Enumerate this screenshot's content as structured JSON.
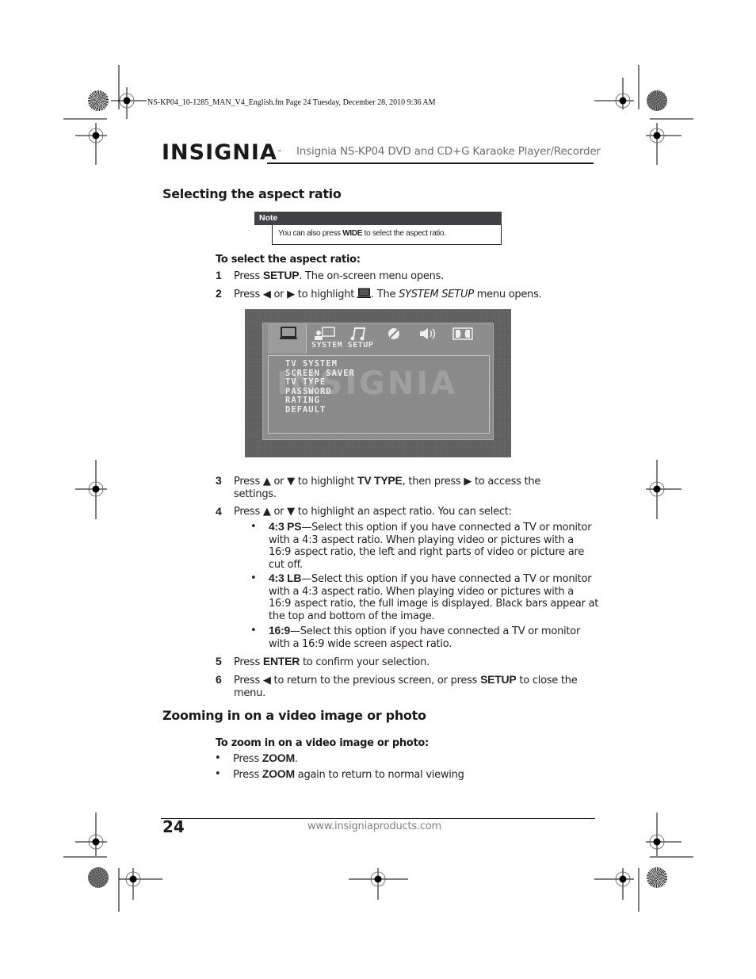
{
  "slugline": "NS-KP04_10-1285_MAN_V4_English.fm  Page 24  Tuesday, December 28, 2010  9:36 AM",
  "header": {
    "logo": "INSIGNIA",
    "logo_tm": "™",
    "title": "Insignia NS-KP04 DVD and CD+G Karaoke Player/Recorder"
  },
  "section1": {
    "heading": "Selecting the aspect ratio",
    "note": {
      "label": "Note",
      "text_before": "You can also press ",
      "keyword": "WIDE",
      "text_after": " to select the aspect ratio."
    },
    "procedure_title": "To select the aspect ratio:",
    "steps": [
      {
        "num": "1",
        "pre": "Press ",
        "kw": "SETUP",
        "post": ". The on-screen menu opens."
      },
      {
        "num": "2",
        "pre": "Press ◀ or ▶ to highlight ",
        "icon": "monitor-icon",
        "mid": ". The ",
        "em": "SYSTEM SETUP",
        "post": " menu opens."
      },
      {
        "num": "3",
        "pre": "Press ▲ or ▼ to highlight ",
        "kw": "TV TYPE",
        "post": ", then press ▶ to access the settings."
      },
      {
        "num": "4",
        "pre": "Press ▲ or ▼ to highlight an aspect ratio. You can select:"
      },
      {
        "num": "5",
        "pre": "Press ",
        "kw": "ENTER",
        "post": " to confirm your selection."
      },
      {
        "num": "6",
        "pre": "Press ◀ to return to the previous screen, or press ",
        "kw": "SETUP",
        "post": " to close the menu."
      }
    ],
    "options": [
      {
        "kw": "4:3 PS",
        "text": "—Select this option if you have connected a TV or monitor with a 4:3 aspect ratio. When playing video or pictures with a 16:9 aspect ratio, the left and right parts of video or picture are cut off."
      },
      {
        "kw": "4:3 LB",
        "text": "—Select this option if you have connected a TV or monitor with a 4:3 aspect ratio. When playing video or pictures with a 16:9 aspect ratio, the full image is displayed. Black bars appear at the top and bottom of the image."
      },
      {
        "kw": "16:9",
        "text": "—Select this option if you have connected a TV or monitor with a 16:9 wide screen aspect ratio."
      }
    ],
    "osd": {
      "tabs": [
        "monitor-icon",
        "person-screen-icon",
        "music-note-icon",
        "disc-icon",
        "speaker-icon",
        "dolby-icon"
      ],
      "title": "SYSTEM SETUP",
      "watermark": "INSIGNIA",
      "items": [
        "TV SYSTEM",
        "SCREEN SAVER",
        "TV TYPE",
        "PASSWORD",
        "RATING",
        "DEFAULT"
      ]
    }
  },
  "section2": {
    "heading": "Zooming in on a video image or photo",
    "procedure_title": "To zoom in on a video image or photo:",
    "bullets": [
      {
        "pre": "Press ",
        "kw": "ZOOM",
        "post": "."
      },
      {
        "pre": "Press ",
        "kw": "ZOOM",
        "post": " again to return to normal viewing"
      }
    ]
  },
  "footer": {
    "page_number": "24",
    "url": "www.insigniaproducts.com"
  }
}
